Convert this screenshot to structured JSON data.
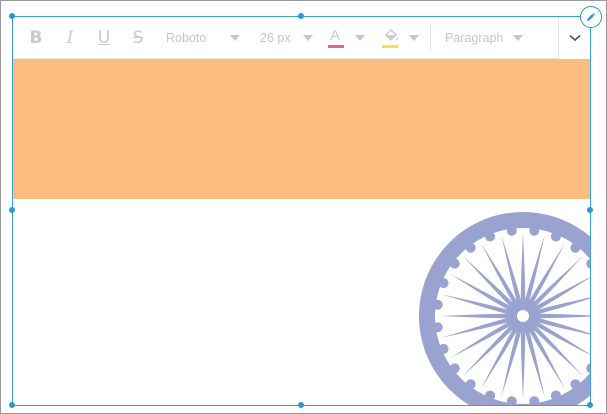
{
  "toolbar": {
    "bold_glyph": "B",
    "italic_glyph": "I",
    "underline_glyph": "U",
    "strike_glyph": "S",
    "font_family": "Roboto",
    "font_size": "26 px",
    "text_color_glyph": "A",
    "text_color": "#e8636b",
    "highlight_color": "#f4e44c",
    "block_format": "Paragraph",
    "icons": {
      "highlight": "paint-bucket-icon",
      "expand": "chevron-down-icon",
      "edit": "pencil-icon"
    }
  },
  "flag": {
    "top_color": "#fbbc80",
    "middle_color": "#ffffff",
    "chakra_color": "#9aa2cf",
    "chakra_spokes": 24
  },
  "selection": {
    "color": "#3ba0d8"
  }
}
